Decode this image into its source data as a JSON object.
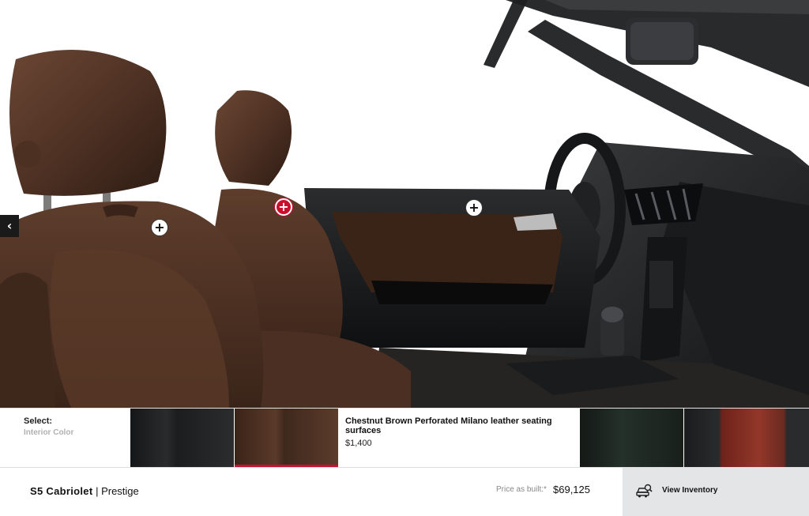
{
  "viewer": {
    "hotspots": [
      "+",
      "+",
      "+"
    ],
    "prev_arrow": "‹"
  },
  "swatch_bar": {
    "select_title": "Select:",
    "select_sub": "Interior Color",
    "selected_name": "Chestnut Brown Perforated Milano leather seating surfaces",
    "selected_price": "$1,400",
    "swatch_colors": [
      "#1d1e1f",
      "#4a3123",
      "#1f2a24",
      "#8a2f24"
    ],
    "accent": "#c8102e"
  },
  "footer": {
    "model": "S5 Cabriolet",
    "separator": " | ",
    "trim": "Prestige",
    "price_label": "Price as built:*",
    "price": "$69,125",
    "inventory_label": "View Inventory",
    "inventory_icon": "car-search-icon"
  }
}
